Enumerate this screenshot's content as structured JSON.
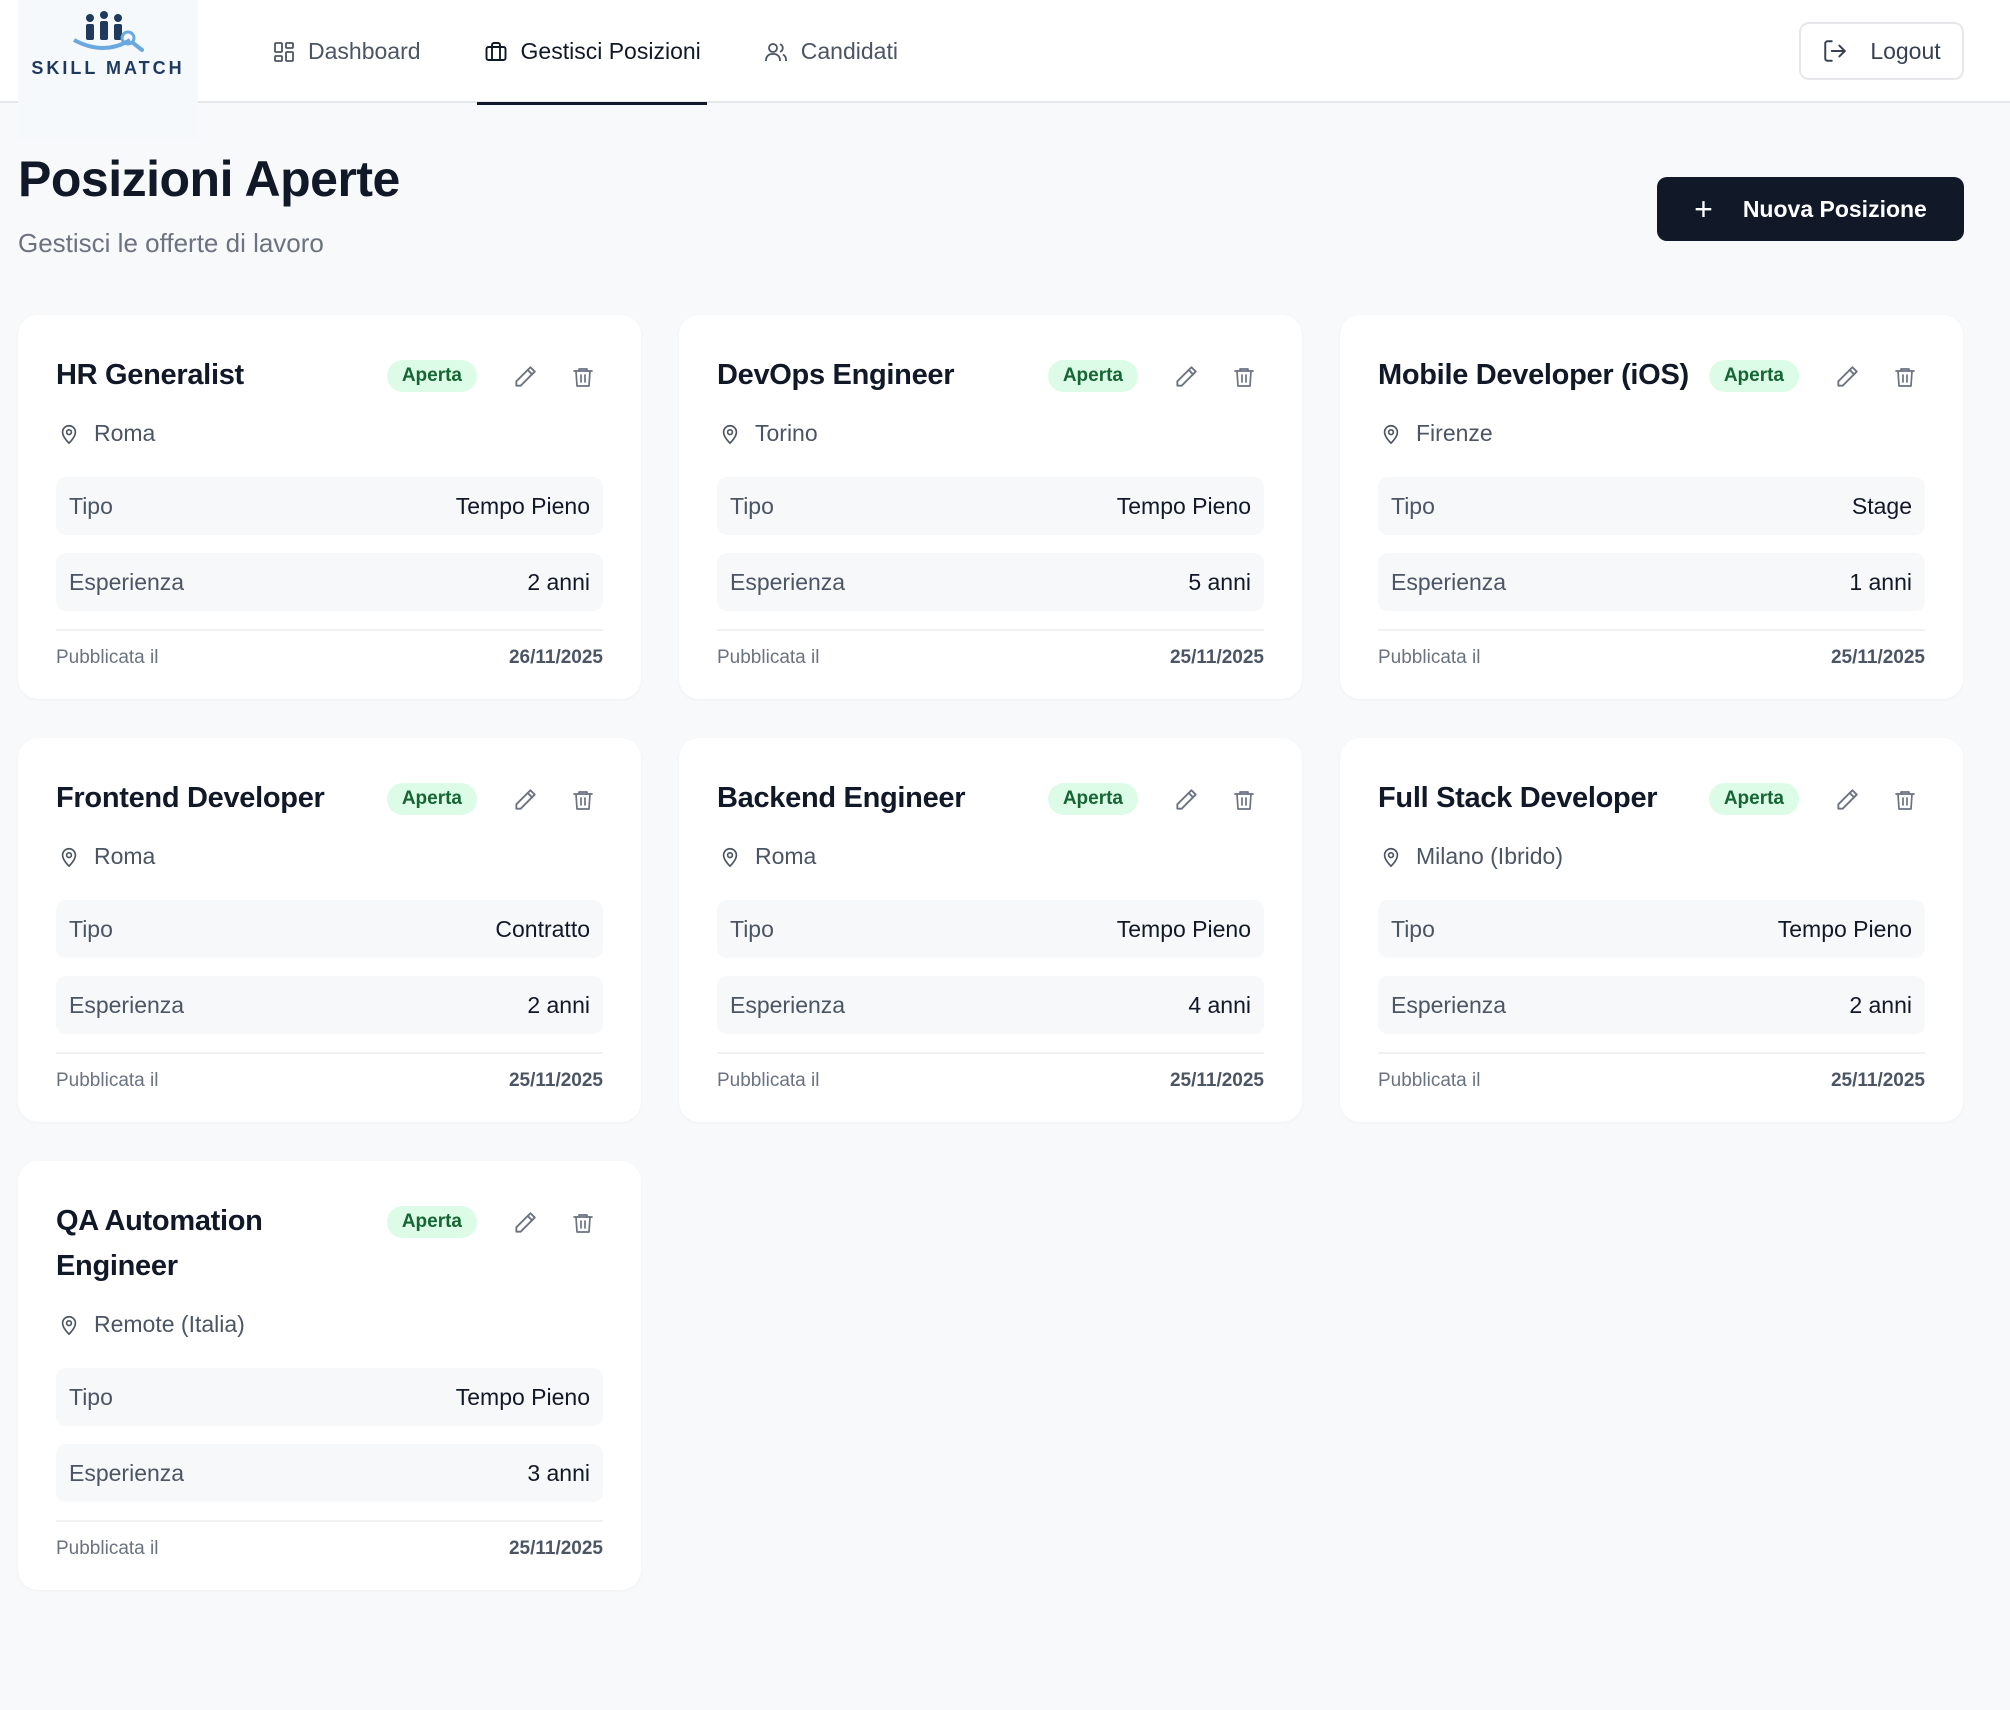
{
  "header": {
    "logo_text": "SKILL MATCH",
    "nav": [
      {
        "label": "Dashboard",
        "icon": "grid-icon"
      },
      {
        "label": "Gestisci Posizioni",
        "icon": "briefcase-icon",
        "active": true
      },
      {
        "label": "Candidati",
        "icon": "users-icon"
      }
    ],
    "logout_label": "Logout"
  },
  "page": {
    "title": "Posizioni Aperte",
    "subtitle": "Gestisci le offerte di lavoro",
    "new_button_label": "Nuova Posizione"
  },
  "labels": {
    "tipo": "Tipo",
    "esperienza": "Esperienza",
    "pubblicata": "Pubblicata il"
  },
  "positions": [
    {
      "title": "HR Generalist",
      "status": "Aperta",
      "location": "Roma",
      "tipo": "Tempo Pieno",
      "esperienza": "2 anni",
      "data": "26/11/2025"
    },
    {
      "title": "DevOps Engineer",
      "status": "Aperta",
      "location": "Torino",
      "tipo": "Tempo Pieno",
      "esperienza": "5 anni",
      "data": "25/11/2025"
    },
    {
      "title": "Mobile Developer (iOS)",
      "status": "Aperta",
      "location": "Firenze",
      "tipo": "Stage",
      "esperienza": "1 anni",
      "data": "25/11/2025"
    },
    {
      "title": "Frontend Developer",
      "status": "Aperta",
      "location": "Roma",
      "tipo": "Contratto",
      "esperienza": "2 anni",
      "data": "25/11/2025"
    },
    {
      "title": "Backend Engineer",
      "status": "Aperta",
      "location": "Roma",
      "tipo": "Tempo Pieno",
      "esperienza": "4 anni",
      "data": "25/11/2025"
    },
    {
      "title": "Full Stack Developer",
      "status": "Aperta",
      "location": "Milano (Ibrido)",
      "tipo": "Tempo Pieno",
      "esperienza": "2 anni",
      "data": "25/11/2025"
    },
    {
      "title": "QA Automation Engineer",
      "status": "Aperta",
      "location": "Remote (Italia)",
      "tipo": "Tempo Pieno",
      "esperienza": "3 anni",
      "data": "25/11/2025"
    }
  ],
  "colors": {
    "accent": "#111827",
    "badge_bg": "#dcfce7",
    "badge_text": "#166534",
    "page_bg": "#f8f9fb"
  }
}
